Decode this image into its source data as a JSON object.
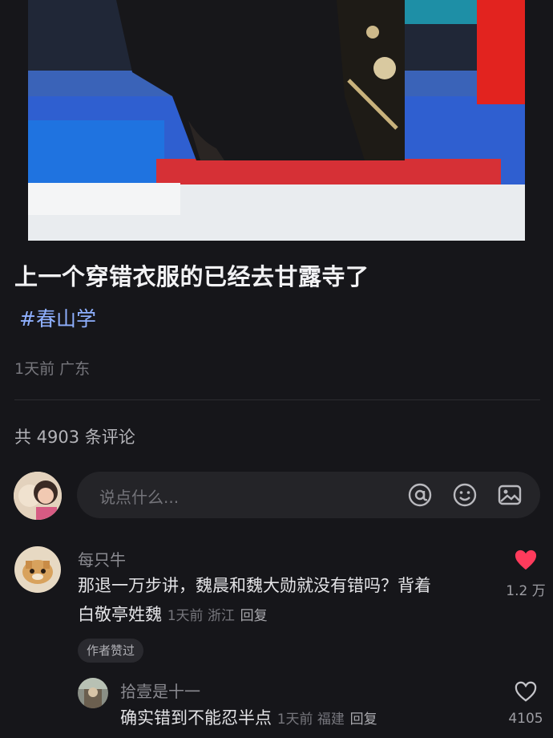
{
  "post": {
    "title": "上一个穿错衣服的已经去甘露寺了",
    "hashtag": "#春山学",
    "meta": "1天前 广东"
  },
  "comments_header": "共 4903 条评论",
  "input": {
    "placeholder": "说点什么...",
    "icons": [
      "at-icon",
      "emoji-icon",
      "image-icon"
    ]
  },
  "comments": [
    {
      "name": "每只牛",
      "text_line1": "那退一万步讲，魏晨和魏大勋就没有错吗？背着",
      "text_line2": "白敬亭姓魏",
      "time": "1天前 浙江",
      "reply": "回复",
      "author_badge": "作者赞过",
      "likes": "1.2 万",
      "liked": true,
      "like_color": "#ff3b5c"
    },
    {
      "name": "拾壹是十一",
      "text": "确实错到不能忍半点",
      "time": "1天前 福建",
      "reply": "回复",
      "likes": "4105",
      "liked": false
    }
  ]
}
